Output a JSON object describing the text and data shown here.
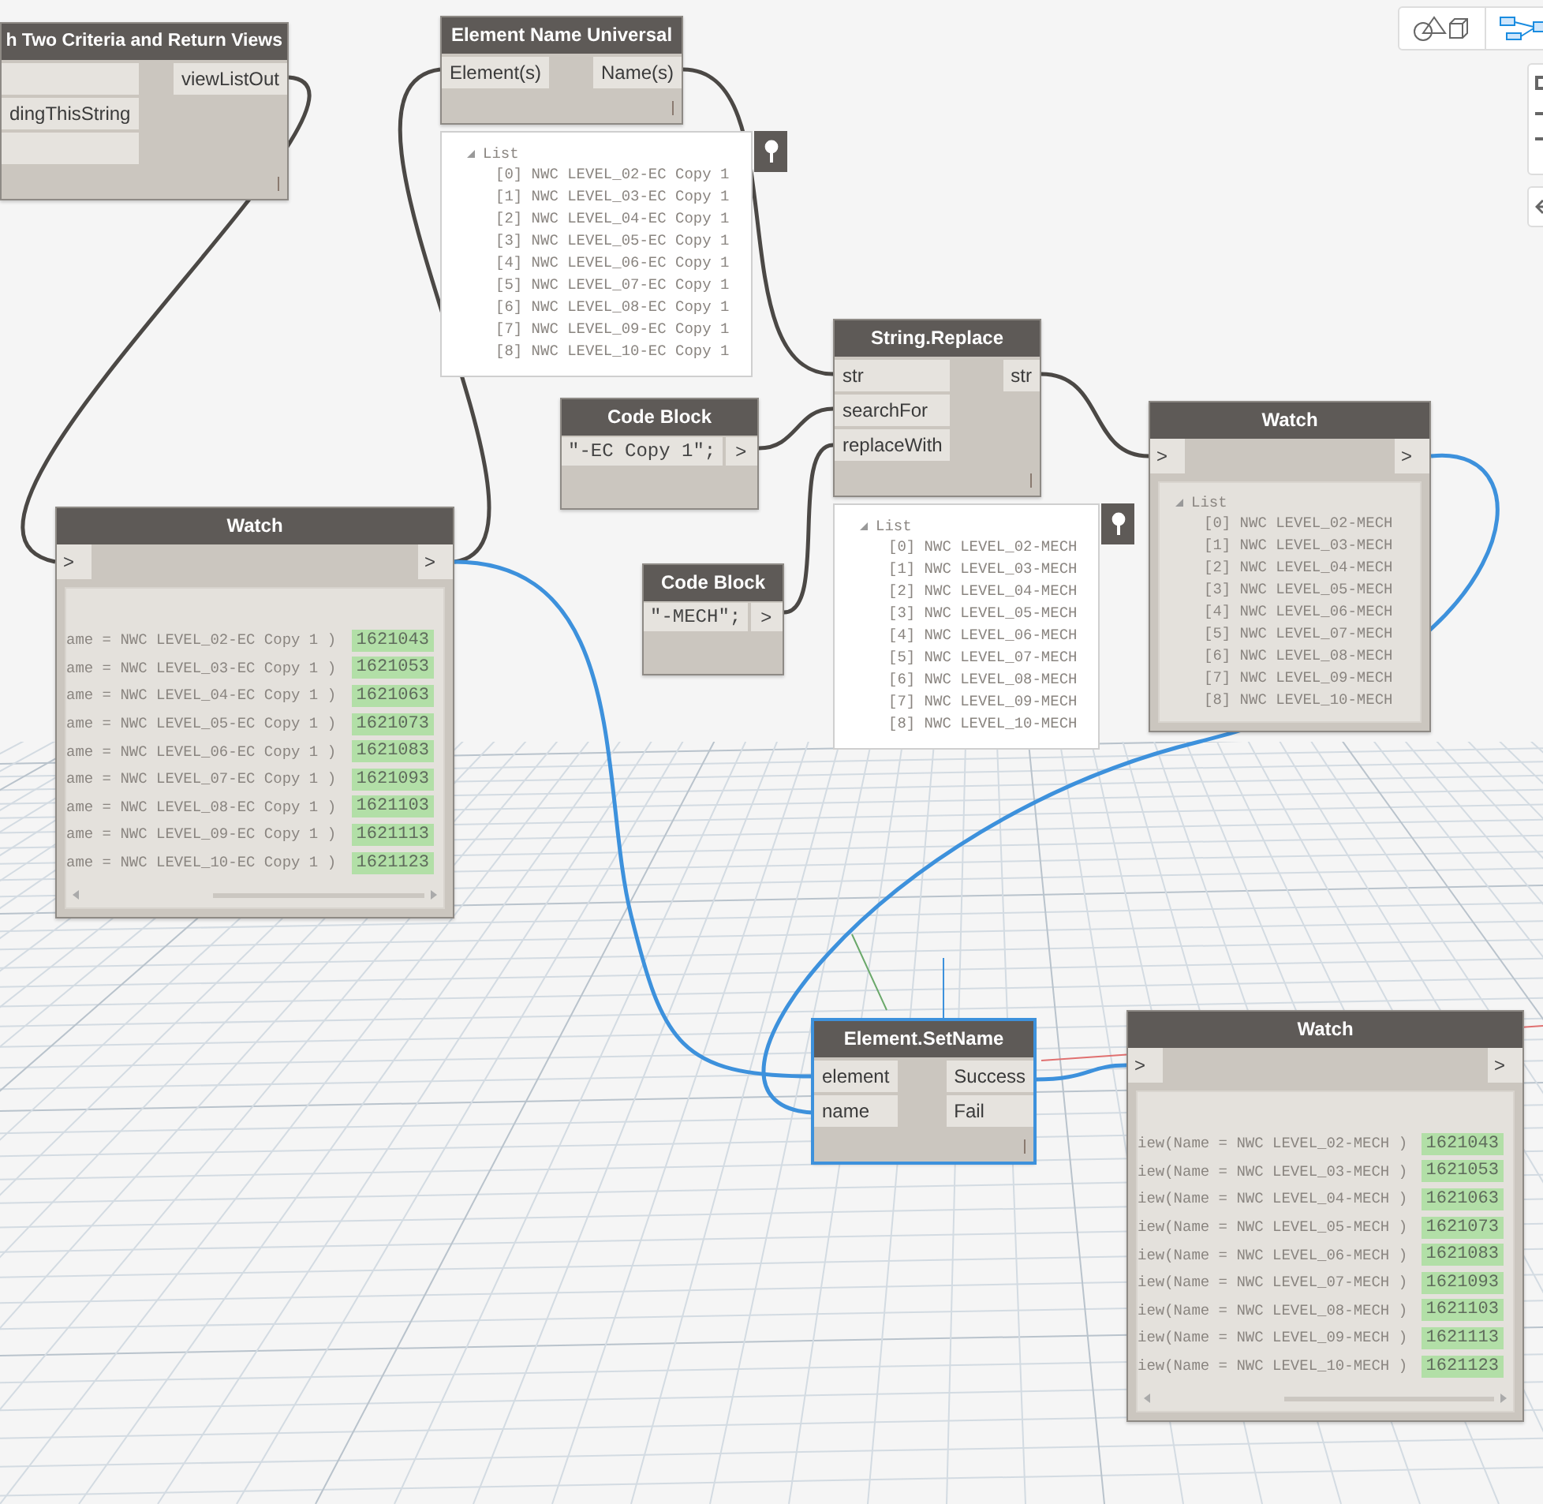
{
  "nodes": [
    {
      "kind": "node",
      "title": "h Two Criteria and Return Views",
      "selected": false,
      "inputs": [
        {
          "kind": "blank"
        },
        {
          "kind": "labeled",
          "label": "dingThisString"
        },
        {
          "kind": "blank"
        }
      ],
      "outputs": [
        {
          "label": "viewListOut"
        }
      ]
    },
    {
      "kind": "node",
      "title": "Element Name Universal",
      "selected": false,
      "inputs": [
        {
          "label": "Element(s)"
        }
      ],
      "outputs": [
        {
          "label": "Name(s)"
        }
      ],
      "preview": {
        "pinned": true,
        "header": "List",
        "items": [
          "[0] NWC LEVEL_02-EC Copy 1",
          "[1] NWC LEVEL_03-EC Copy 1",
          "[2] NWC LEVEL_04-EC Copy 1",
          "[3] NWC LEVEL_05-EC Copy 1",
          "[4] NWC LEVEL_06-EC Copy 1",
          "[5] NWC LEVEL_07-EC Copy 1",
          "[6] NWC LEVEL_08-EC Copy 1",
          "[7] NWC LEVEL_09-EC Copy 1",
          "[8] NWC LEVEL_10-EC Copy 1"
        ]
      }
    },
    {
      "kind": "code",
      "title": "Code Block",
      "selected": false,
      "code": "\"-EC Copy 1\";",
      "out_port": ">"
    },
    {
      "kind": "node",
      "title": "String.Replace",
      "selected": false,
      "inputs": [
        {
          "label": "str"
        },
        {
          "label": "searchFor"
        },
        {
          "label": "replaceWith"
        }
      ],
      "outputs": [
        {
          "label": "str"
        }
      ],
      "preview": {
        "pinned": true,
        "header": "List",
        "items": [
          "[0] NWC LEVEL_02-MECH",
          "[1] NWC LEVEL_03-MECH",
          "[2] NWC LEVEL_04-MECH",
          "[3] NWC LEVEL_05-MECH",
          "[4] NWC LEVEL_06-MECH",
          "[5] NWC LEVEL_07-MECH",
          "[6] NWC LEVEL_08-MECH",
          "[7] NWC LEVEL_09-MECH",
          "[8] NWC LEVEL_10-MECH"
        ]
      }
    },
    {
      "kind": "code",
      "title": "Code Block",
      "selected": false,
      "code": "\"-MECH\";",
      "out_port": ">"
    },
    {
      "kind": "watch",
      "title": "Watch",
      "selected": false,
      "in_port": ">",
      "out_port": ">",
      "content": {
        "kind": "rows",
        "rows": [
          {
            "text": "ame = NWC LEVEL_02-EC Copy 1 )",
            "value": "1621043"
          },
          {
            "text": "ame = NWC LEVEL_03-EC Copy 1 )",
            "value": "1621053"
          },
          {
            "text": "ame = NWC LEVEL_04-EC Copy 1 )",
            "value": "1621063"
          },
          {
            "text": "ame = NWC LEVEL_05-EC Copy 1 )",
            "value": "1621073"
          },
          {
            "text": "ame = NWC LEVEL_06-EC Copy 1 )",
            "value": "1621083"
          },
          {
            "text": "ame = NWC LEVEL_07-EC Copy 1 )",
            "value": "1621093"
          },
          {
            "text": "ame = NWC LEVEL_08-EC Copy 1 )",
            "value": "1621103"
          },
          {
            "text": "ame = NWC LEVEL_09-EC Copy 1 )",
            "value": "1621113"
          },
          {
            "text": "ame = NWC LEVEL_10-EC Copy 1 )",
            "value": "1621123"
          }
        ]
      }
    },
    {
      "kind": "watch",
      "title": "Watch",
      "selected": false,
      "in_port": ">",
      "out_port": ">",
      "content": {
        "kind": "list",
        "header": "List",
        "items": [
          "[0] NWC LEVEL_02-MECH",
          "[1] NWC LEVEL_03-MECH",
          "[2] NWC LEVEL_04-MECH",
          "[3] NWC LEVEL_05-MECH",
          "[4] NWC LEVEL_06-MECH",
          "[5] NWC LEVEL_07-MECH",
          "[6] NWC LEVEL_08-MECH",
          "[7] NWC LEVEL_09-MECH",
          "[8] NWC LEVEL_10-MECH"
        ]
      }
    },
    {
      "kind": "node",
      "title": "Element.SetName",
      "selected": true,
      "inputs": [
        {
          "label": "element"
        },
        {
          "label": "name"
        }
      ],
      "outputs": [
        {
          "label": "Success"
        },
        {
          "label": "Fail"
        }
      ]
    },
    {
      "kind": "watch",
      "title": "Watch",
      "selected": false,
      "in_port": ">",
      "out_port": ">",
      "content": {
        "kind": "rows",
        "rows": [
          {
            "text": "iew(Name = NWC LEVEL_02-MECH )",
            "value": "1621043"
          },
          {
            "text": "iew(Name = NWC LEVEL_03-MECH )",
            "value": "1621053"
          },
          {
            "text": "iew(Name = NWC LEVEL_04-MECH )",
            "value": "1621063"
          },
          {
            "text": "iew(Name = NWC LEVEL_05-MECH )",
            "value": "1621073"
          },
          {
            "text": "iew(Name = NWC LEVEL_06-MECH )",
            "value": "1621083"
          },
          {
            "text": "iew(Name = NWC LEVEL_07-MECH )",
            "value": "1621093"
          },
          {
            "text": "iew(Name = NWC LEVEL_08-MECH )",
            "value": "1621103"
          },
          {
            "text": "iew(Name = NWC LEVEL_09-MECH )",
            "value": "1621113"
          },
          {
            "text": "iew(Name = NWC LEVEL_10-MECH )",
            "value": "1621123"
          }
        ]
      }
    }
  ]
}
